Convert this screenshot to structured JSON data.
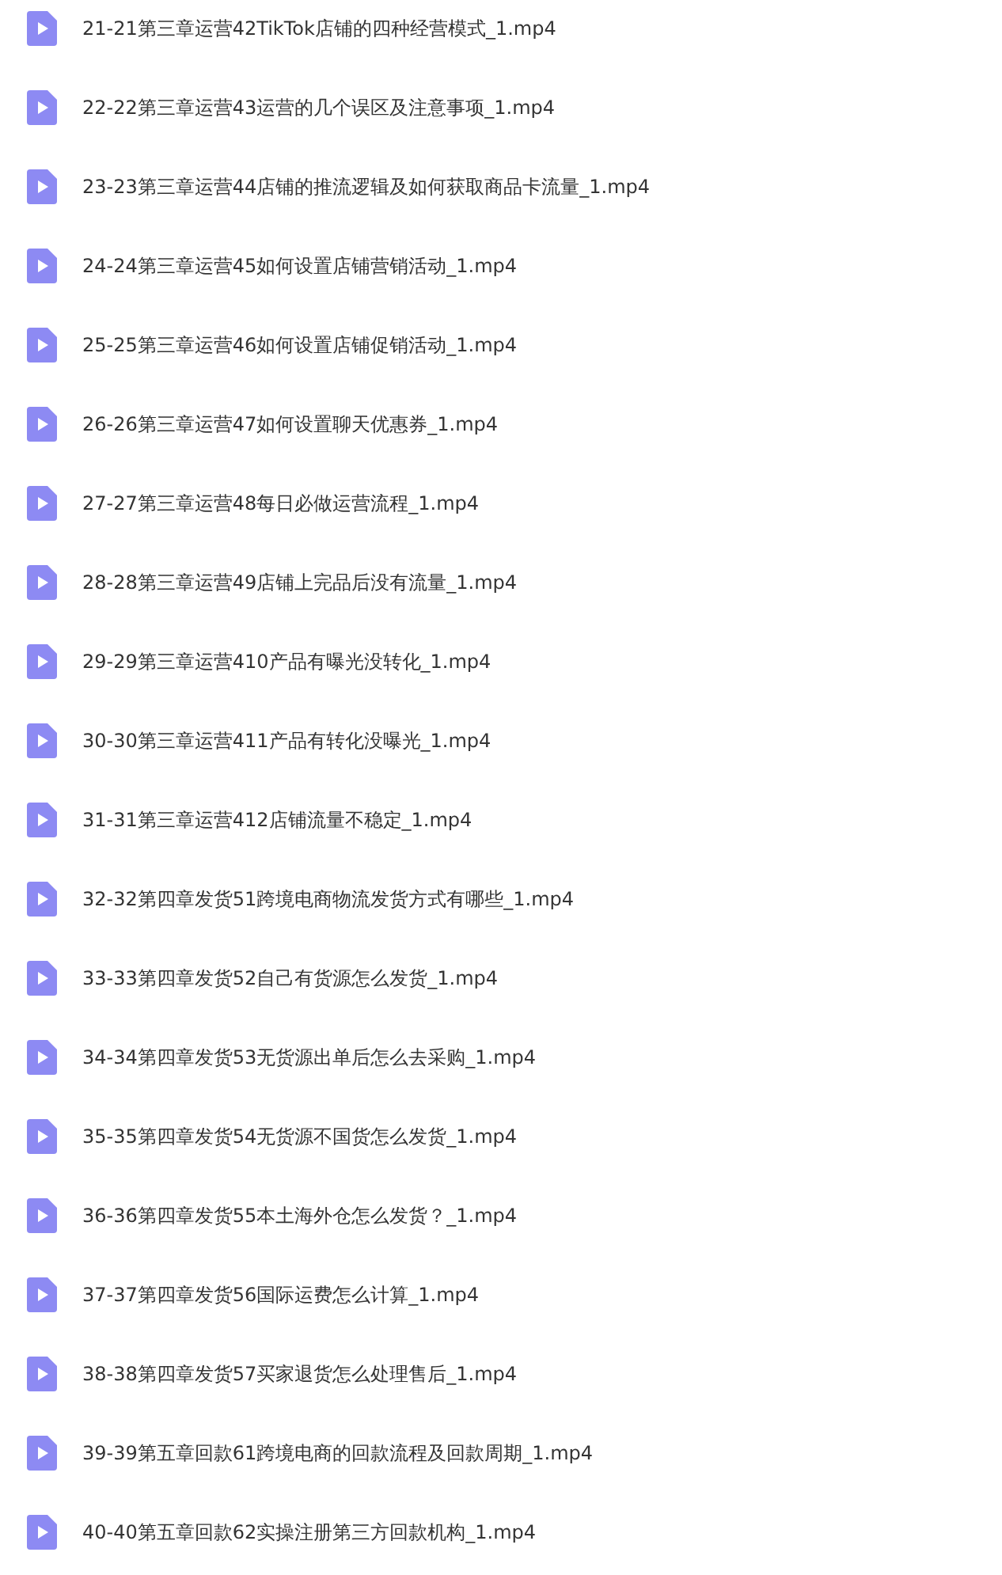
{
  "files": [
    {
      "name": "21-21第三章运营42TikTok店铺的四种经营模式_1.mp4"
    },
    {
      "name": "22-22第三章运营43运营的几个误区及注意事项_1.mp4"
    },
    {
      "name": "23-23第三章运营44店铺的推流逻辑及如何获取商品卡流量_1.mp4"
    },
    {
      "name": "24-24第三章运营45如何设置店铺营销活动_1.mp4"
    },
    {
      "name": "25-25第三章运营46如何设置店铺促销活动_1.mp4"
    },
    {
      "name": "26-26第三章运营47如何设置聊天优惠券_1.mp4"
    },
    {
      "name": "27-27第三章运营48每日必做运营流程_1.mp4"
    },
    {
      "name": "28-28第三章运营49店铺上完品后没有流量_1.mp4"
    },
    {
      "name": "29-29第三章运营410产品有曝光没转化_1.mp4"
    },
    {
      "name": "30-30第三章运营411产品有转化没曝光_1.mp4"
    },
    {
      "name": "31-31第三章运营412店铺流量不稳定_1.mp4"
    },
    {
      "name": "32-32第四章发货51跨境电商物流发货方式有哪些_1.mp4"
    },
    {
      "name": "33-33第四章发货52自己有货源怎么发货_1.mp4"
    },
    {
      "name": "34-34第四章发货53无货源出单后怎么去采购_1.mp4"
    },
    {
      "name": "35-35第四章发货54无货源不国货怎么发货_1.mp4"
    },
    {
      "name": "36-36第四章发货55本土海外仓怎么发货？_1.mp4"
    },
    {
      "name": "37-37第四章发货56国际运费怎么计算_1.mp4"
    },
    {
      "name": "38-38第四章发货57买家退货怎么处理售后_1.mp4"
    },
    {
      "name": "39-39第五章回款61跨境电商的回款流程及回款周期_1.mp4"
    },
    {
      "name": "40-40第五章回款62实操注册第三方回款机构_1.mp4"
    }
  ]
}
